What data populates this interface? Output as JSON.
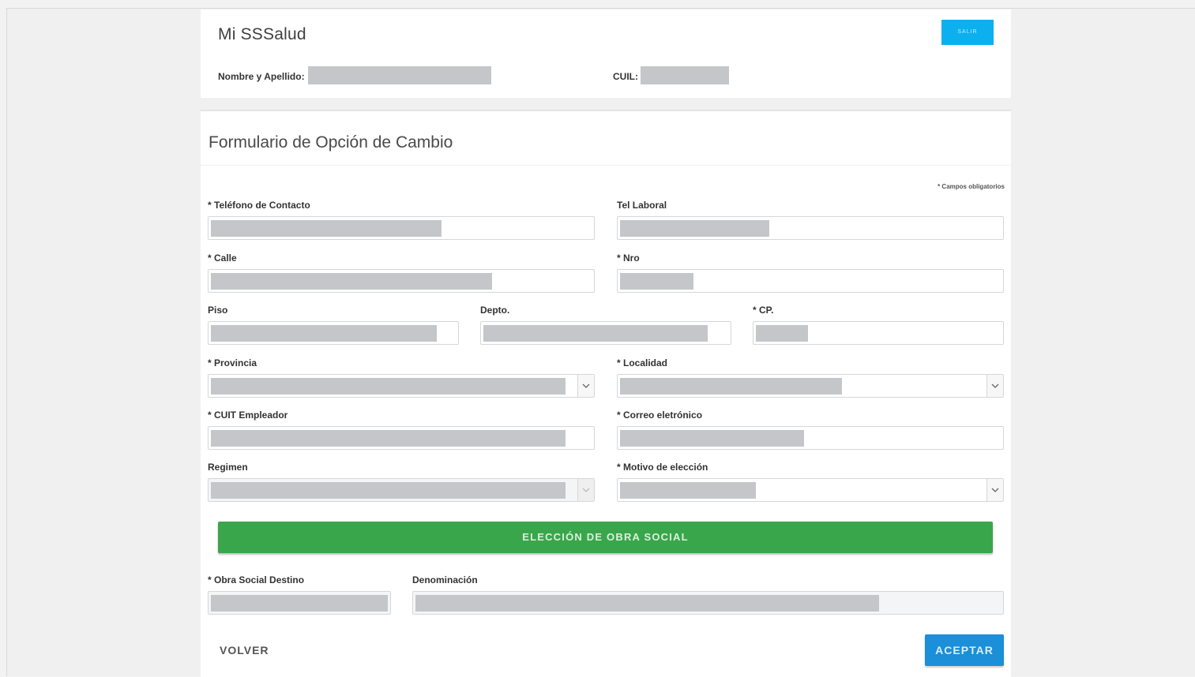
{
  "header": {
    "app_title": "Mi SSSalud",
    "logout_label": "SALIR",
    "name_label": "Nombre y Apellido:",
    "cuil_label": "CUIL:"
  },
  "form": {
    "title": "Formulario de Opción de Cambio",
    "required_note": "* Campos obligatorios",
    "labels": {
      "telefono": "* Teléfono de Contacto",
      "tel_laboral": "Tel Laboral",
      "calle": "* Calle",
      "nro": "* Nro",
      "piso": "Piso",
      "depto": "Depto.",
      "cp": "* CP.",
      "provincia": "* Provincia",
      "localidad": "* Localidad",
      "cuit": "* CUIT Empleador",
      "correo": "* Correo eletrónico",
      "regimen": "Regimen",
      "motivo": "* Motivo de elección",
      "obra_destino": "* Obra Social Destino",
      "denominacion": "Denominación"
    },
    "eleccion_button": "ELECCIÓN DE OBRA SOCIAL",
    "volver_button": "VOLVER",
    "aceptar_button": "ACEPTAR"
  },
  "icons": {
    "select_caret": "chevron-down-icon"
  },
  "colors": {
    "salir": "#0cb0ee",
    "eleccion": "#3aa64c",
    "aceptar": "#1b8fd8",
    "redaction": "#c4c6ca"
  }
}
